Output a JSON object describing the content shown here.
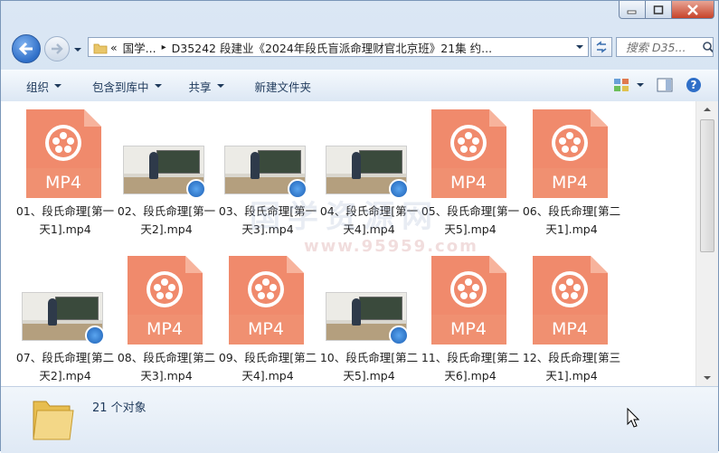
{
  "window": {
    "caption_buttons": [
      "minimize",
      "maximize",
      "close"
    ]
  },
  "address": {
    "overflow_marker": "«",
    "crumbs": [
      "国学...",
      "D35242 段建业《2024年段氏盲派命理财官北京班》21集 约..."
    ],
    "separator": "▸"
  },
  "search": {
    "placeholder": "搜索 D35..."
  },
  "toolbar": {
    "organize": "组织",
    "include_library": "包含到库中",
    "share": "共享",
    "new_folder": "新建文件夹"
  },
  "files": [
    {
      "name": "01、段氏命理[第一天1].mp4",
      "kind": "mp4-icon"
    },
    {
      "name": "02、段氏命理[第一天2].mp4",
      "kind": "video-thumb"
    },
    {
      "name": "03、段氏命理[第一天3].mp4",
      "kind": "video-thumb"
    },
    {
      "name": "04、段氏命理[第一天4].mp4",
      "kind": "video-thumb"
    },
    {
      "name": "05、段氏命理[第一天5].mp4",
      "kind": "mp4-icon"
    },
    {
      "name": "06、段氏命理[第二天1].mp4",
      "kind": "mp4-icon"
    },
    {
      "name": "07、段氏命理[第二天2].mp4",
      "kind": "video-thumb"
    },
    {
      "name": "08、段氏命理[第二天3].mp4",
      "kind": "mp4-icon"
    },
    {
      "name": "09、段氏命理[第二天4].mp4",
      "kind": "mp4-icon"
    },
    {
      "name": "10、段氏命理[第二天5].mp4",
      "kind": "video-thumb"
    },
    {
      "name": "11、段氏命理[第二天6].mp4",
      "kind": "mp4-icon"
    },
    {
      "name": "12、段氏命理[第三天1].mp4",
      "kind": "mp4-icon"
    }
  ],
  "icon_label": "MP4",
  "watermark": {
    "line1": "国学资源网",
    "line2": "www.95959.com"
  },
  "status": {
    "count": "21 个对象"
  },
  "colors": {
    "mp4_orange": "#f08a6c",
    "mp4_light": "#f7b39c",
    "toolbar_text": "#1e395b"
  }
}
